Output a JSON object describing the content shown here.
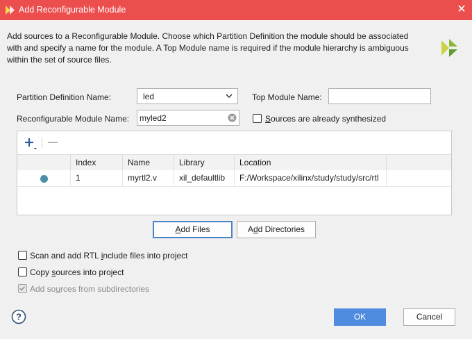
{
  "window": {
    "title": "Add Reconfigurable Module",
    "close_glyph": "✕",
    "colors": {
      "titlebar": "#ec4e4e",
      "accent": "#4f8ce0"
    }
  },
  "description": [
    "Add sources to a Reconfigurable Module. Choose which Partition Definition the module should be associated",
    "with and specify a name for the module. A Top Module name is required if the module hierarchy is ambiguous",
    "within the set of source files."
  ],
  "form": {
    "partition_label": "Partition Definition Name:",
    "partition_value": "led",
    "top_module_label": "Top Module Name:",
    "top_module_value": "",
    "rm_name_label": "Reconfigurable Module Name:",
    "rm_name_value": "myled2",
    "synth_prefix": "",
    "synth_mnemonic": "S",
    "synth_rest": "ources are already synthesized",
    "synth_checked": false
  },
  "toolbar": {
    "add_icon": "plus-icon",
    "remove_icon": "minus-icon"
  },
  "table": {
    "columns": [
      "",
      "Index",
      "Name",
      "Library",
      "Location"
    ],
    "rows": [
      {
        "status": "file-dot-icon",
        "index": "1",
        "name": "myrtl2.v",
        "library": "xil_defaultlib",
        "location": "F:/Workspace/xilinx/study/study/src/rtl"
      }
    ]
  },
  "buttons": {
    "add_files_mnemonic": "A",
    "add_files_rest": "dd Files",
    "add_dirs_prefix": "A",
    "add_dirs_mnemonic": "d",
    "add_dirs_rest": "d Directories",
    "ok": "OK",
    "cancel": "Cancel"
  },
  "options": {
    "scan_prefix": "Scan and add RTL ",
    "scan_mnemonic": "i",
    "scan_rest": "nclude files into project",
    "scan_checked": false,
    "copy_prefix": "Copy ",
    "copy_mnemonic": "s",
    "copy_rest": "ources into project",
    "copy_checked": false,
    "subdirs_prefix": "Add so",
    "subdirs_mnemonic": "u",
    "subdirs_rest": "rces from subdirectories",
    "subdirs_checked": true,
    "subdirs_enabled": false
  },
  "help": {
    "icon": "help-icon",
    "glyph": "?"
  }
}
